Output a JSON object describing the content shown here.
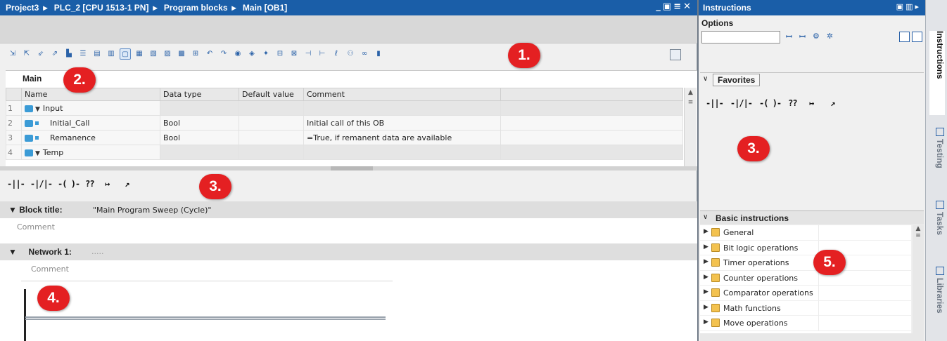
{
  "editor": {
    "breadcrumb": [
      "Project3",
      "PLC_2 [CPU 1513-1 PN]",
      "Program blocks",
      "Main [OB1]"
    ],
    "block_name": "Main",
    "columns": [
      "Name",
      "Data type",
      "Default value",
      "Comment"
    ],
    "rows": [
      {
        "num": "1",
        "name": "Input",
        "type": "",
        "default": "",
        "comment": ""
      },
      {
        "num": "2",
        "name": "Initial_Call",
        "type": "Bool",
        "default": "",
        "comment": "Initial call of this OB"
      },
      {
        "num": "3",
        "name": "Remanence",
        "type": "Bool",
        "default": "",
        "comment": "=True, if remanent data are available"
      },
      {
        "num": "4",
        "name": "Temp",
        "type": "",
        "default": "",
        "comment": ""
      }
    ],
    "lad_elements": [
      "-||-",
      "-|/|-",
      "-( )-",
      "??",
      "↦",
      "↗"
    ],
    "block_title_label": "Block title:",
    "block_title_value": "\"Main Program Sweep (Cycle)\"",
    "comment_placeholder": "Comment",
    "network_label": "Network 1:",
    "network_dots": "....."
  },
  "badges": {
    "b1": "1.",
    "b2": "2.",
    "b3": "3.",
    "b4": "4.",
    "b5": "5."
  },
  "panel": {
    "title": "Instructions",
    "options_label": "Options",
    "favorites_label": "Favorites",
    "fav_elements": [
      "-||-",
      "-|/|-",
      "-( )-",
      "??",
      "↦",
      "↗"
    ],
    "basic_label": "Basic instructions",
    "basic_items": [
      {
        "label": "General",
        "icon": "folder-icon"
      },
      {
        "label": "Bit logic operations",
        "icon": "bit-logic-icon"
      },
      {
        "label": "Timer operations",
        "icon": "timer-icon"
      },
      {
        "label": "Counter operations",
        "icon": "counter-icon"
      },
      {
        "label": "Comparator operations",
        "icon": "comparator-icon"
      },
      {
        "label": "Math functions",
        "icon": "math-icon"
      },
      {
        "label": "Move operations",
        "icon": "move-icon"
      }
    ]
  },
  "side_tabs": [
    "Instructions",
    "Testing",
    "Tasks",
    "Libraries"
  ]
}
